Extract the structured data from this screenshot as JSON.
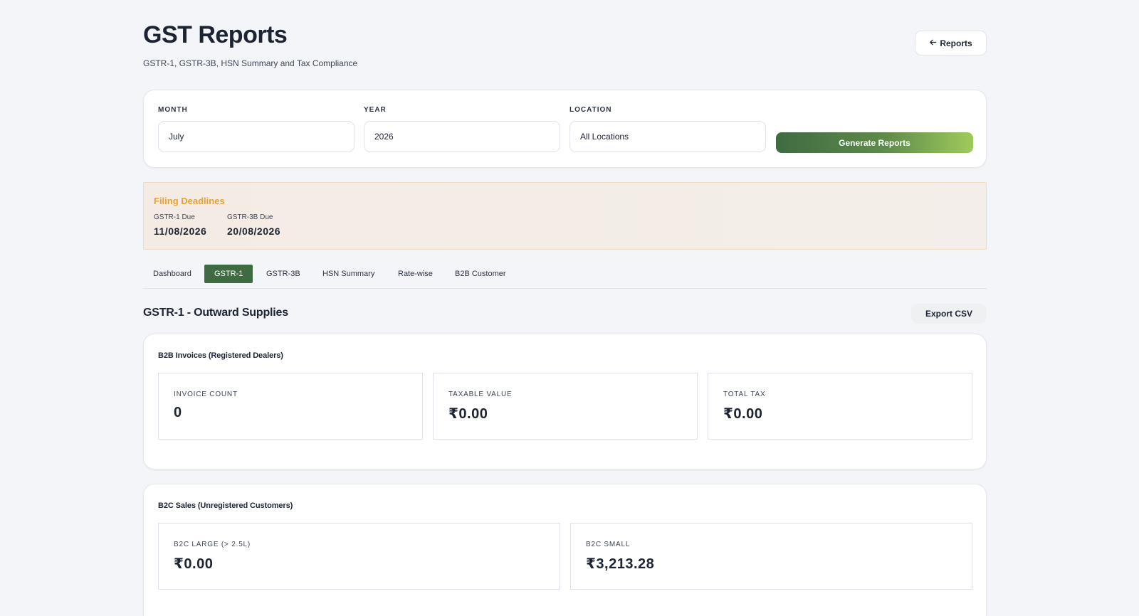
{
  "header": {
    "title": "GST Reports",
    "subtitle": "GSTR-1, GSTR-3B, HSN Summary and Tax Compliance",
    "back_label": "Reports"
  },
  "filters": {
    "month": {
      "label": "MONTH",
      "value": "July"
    },
    "year": {
      "label": "YEAR",
      "value": "2026"
    },
    "location": {
      "label": "LOCATION",
      "value": "All Locations"
    },
    "generate_label": "Generate Reports"
  },
  "deadlines": {
    "title": "Filing Deadlines",
    "gstr1": {
      "label": "GSTR-1 Due",
      "value": "11/08/2026"
    },
    "gstr3b": {
      "label": "GSTR-3B Due",
      "value": "20/08/2026"
    }
  },
  "tabs": [
    {
      "label": "Dashboard",
      "active": false
    },
    {
      "label": "GSTR-1",
      "active": true
    },
    {
      "label": "GSTR-3B",
      "active": false
    },
    {
      "label": "HSN Summary",
      "active": false
    },
    {
      "label": "Rate-wise",
      "active": false
    },
    {
      "label": "B2B Customer",
      "active": false
    }
  ],
  "section": {
    "title": "GSTR-1 - Outward Supplies",
    "export_label": "Export CSV"
  },
  "b2b": {
    "title": "B2B Invoices (Registered Dealers)",
    "stats": [
      {
        "label": "INVOICE COUNT",
        "value": "0"
      },
      {
        "label": "TAXABLE VALUE",
        "value": "₹0.00"
      },
      {
        "label": "TOTAL TAX",
        "value": "₹0.00"
      }
    ]
  },
  "b2c": {
    "title": "B2C Sales (Unregistered Customers)",
    "stats": [
      {
        "label": "B2C LARGE (> 2.5L)",
        "value": "₹0.00"
      },
      {
        "label": "B2C SMALL",
        "value": "₹3,213.28"
      }
    ]
  },
  "colors": {
    "accent_green": "#3f6b42",
    "deadline_orange": "#e3a23a"
  },
  "icons": {
    "back": "arrow-left-icon"
  }
}
